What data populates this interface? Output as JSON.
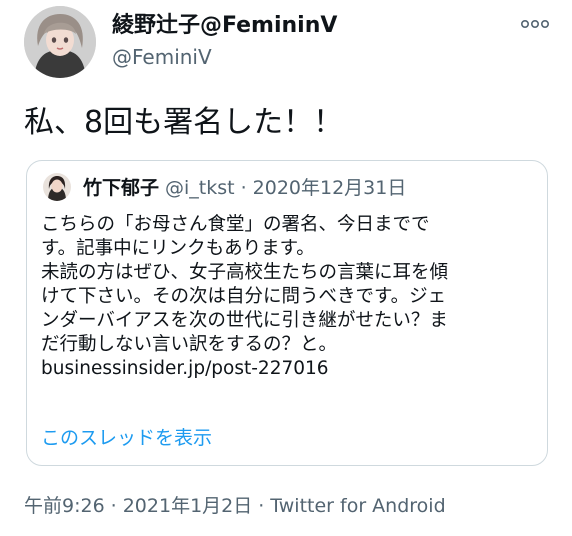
{
  "author": {
    "display_name": "綾野辻子@FemininV",
    "handle": "@FeminiV"
  },
  "tweet": {
    "text": "私、8回も署名した！！"
  },
  "quote": {
    "name": "竹下郁子",
    "handle": "@i_tkst",
    "separator": "·",
    "date": "2020年12月31日",
    "lines": [
      "こちらの「お母さん食堂」の署名、今日までで",
      "す。記事中にリンクもあります。",
      "未読の方はぜひ、女子高校生たちの言葉に耳を傾",
      "けて下さい。その次は自分に問うべきです。ジェ",
      "ンダーバイアスを次の世代に引き継がせたい？ま",
      "だ行動しない言い訳をするの？と。"
    ],
    "link": "businessinsider.jp/post-227016",
    "show_thread": "このスレッドを表示"
  },
  "footer": {
    "time": "午前9:26",
    "separator": "·",
    "date": "2021年1月2日",
    "source": "Twitter for Android"
  },
  "icons": {
    "more": "more-horizontal-icon"
  },
  "colors": {
    "link_blue": "#1d9bf0",
    "secondary_text": "#536471",
    "border": "#cfd9de"
  }
}
